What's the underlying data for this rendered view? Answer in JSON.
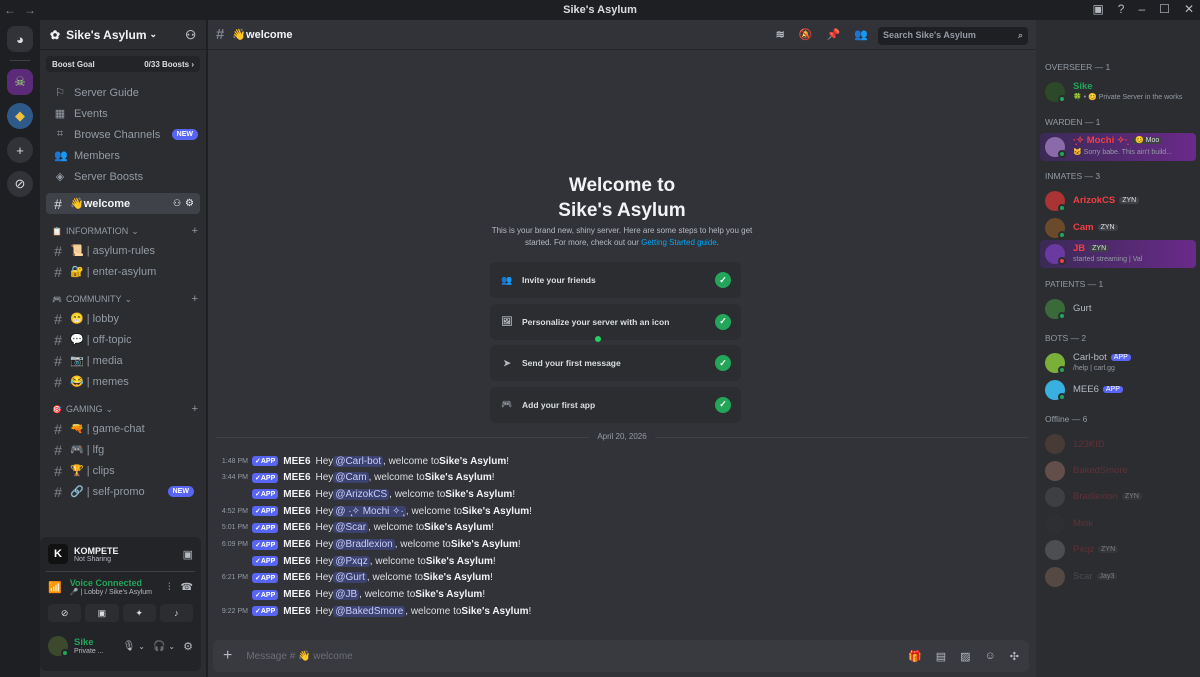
{
  "window": {
    "title": "Sike's Asylum"
  },
  "server": {
    "name": "Sike's Asylum",
    "boost_label": "Boost Goal",
    "boost_count": "0/33 Boosts",
    "boost_progress": 0
  },
  "nav": [
    {
      "label": "Server Guide",
      "icon": "signpost-icon"
    },
    {
      "label": "Events",
      "icon": "calendar-icon"
    },
    {
      "label": "Browse Channels",
      "icon": "browse-icon",
      "badge": "NEW"
    },
    {
      "label": "Members",
      "icon": "members-icon"
    },
    {
      "label": "Server Boosts",
      "icon": "boost-icon"
    }
  ],
  "selected_channel": "👋welcome",
  "categories": [
    {
      "name": "INFORMATION",
      "channels": [
        "📜 | asylum-rules",
        "🔐 | enter-asylum"
      ]
    },
    {
      "name": "COMMUNITY",
      "channels": [
        "😁 | lobby",
        "💬 | off-topic",
        "📷 | media",
        "😂 | memes"
      ]
    },
    {
      "name": "GAMING",
      "channels": [
        "🔫 | game-chat",
        "🎮 | lfg",
        "🏆 | clips",
        "🔗 | self-promo"
      ]
    }
  ],
  "self_promo_badge": "NEW",
  "activity": {
    "name": "KOMPETE",
    "status": "Not Sharing"
  },
  "voice": {
    "status": "Voice Connected",
    "channel": "🎤 | Lobby / Sike's Asylum"
  },
  "user": {
    "name": "Sike",
    "status": "Private ..."
  },
  "chat": {
    "channel": "👋welcome",
    "search_placeholder": "Search Sike's Asylum",
    "welcome_line1": "Welcome to",
    "welcome_line2": "Sike's Asylum",
    "welcome_sub": "This is your brand new, shiny server. Here are some steps to help you get started. For more, check out our",
    "welcome_link": "Getting Started guide",
    "steps": [
      "Invite your friends",
      "Personalize your server with an icon",
      "Send your first message",
      "Add your first app"
    ],
    "date": "April 20, 2026",
    "app_label": "APP",
    "author": "MEE6",
    "server_bold": "Sike's Asylum",
    "messages": [
      {
        "time": "1:48 PM",
        "mention": "@Carl-bot"
      },
      {
        "time": "3:44 PM",
        "mention": "@Cam"
      },
      {
        "time": "",
        "mention": "@ArizokCS"
      },
      {
        "time": "4:52 PM",
        "mention": "@ ·̩͙✧ Mochi ✧·̩͙"
      },
      {
        "time": "5:01 PM",
        "mention": "@Scar"
      },
      {
        "time": "6:09 PM",
        "mention": "@Bradlexion"
      },
      {
        "time": "",
        "mention": "@Pxqz"
      },
      {
        "time": "6:21 PM",
        "mention": "@Gurt"
      },
      {
        "time": "",
        "mention": "@JB"
      },
      {
        "time": "9:22 PM",
        "mention": "@BakedSmore"
      }
    ],
    "composer_placeholder": "Message # 👋 welcome"
  },
  "member_groups": [
    {
      "title": "OVERSEER — 1",
      "members": [
        {
          "name": "Sike",
          "sub": "🍀 • 😊 Private Server in the works",
          "color": "#23a55a"
        }
      ]
    },
    {
      "title": "WARDEN — 1",
      "members": [
        {
          "name": "·̩͙✧ Mochi ✧·̩͙",
          "tag": "😊 Moo",
          "sub": "🐱 Sorry babe. This ain't build...",
          "color": "#f23f43"
        }
      ]
    },
    {
      "title": "INMATES — 3",
      "members": [
        {
          "name": "ArizokCS",
          "tag": "ZYN",
          "color": "#f23f43"
        },
        {
          "name": "Cam",
          "tag": "ZYN",
          "color": "#f23f43"
        },
        {
          "name": "JB",
          "tag": "ZYN",
          "sub": "started streaming | Val",
          "color": "#f23f43"
        }
      ]
    },
    {
      "title": "PATIENTS — 1",
      "members": [
        {
          "name": "Gurt",
          "color": "#b5bac1"
        }
      ]
    },
    {
      "title": "BOTS — 2",
      "members": [
        {
          "name": "Carl-bot",
          "tag": "APP",
          "sub": "/help | carl.gg",
          "color": "#b5bac1"
        },
        {
          "name": "MEE6",
          "tag": "APP",
          "color": "#b5bac1"
        }
      ]
    },
    {
      "title": "Offline — 6",
      "members": [
        {
          "name": "123KID",
          "color": "#a1353a"
        },
        {
          "name": "BakedSmore",
          "color": "#a1353a"
        },
        {
          "name": "Bradlexion",
          "tag": "ZYN",
          "color": "#a1353a"
        },
        {
          "name": "Mink",
          "color": "#a1353a"
        },
        {
          "name": "Pxqz",
          "tag": "ZYN",
          "color": "#a1353a"
        },
        {
          "name": "Scar",
          "tag": "Jay3",
          "color": "#6d6f78"
        }
      ]
    }
  ]
}
